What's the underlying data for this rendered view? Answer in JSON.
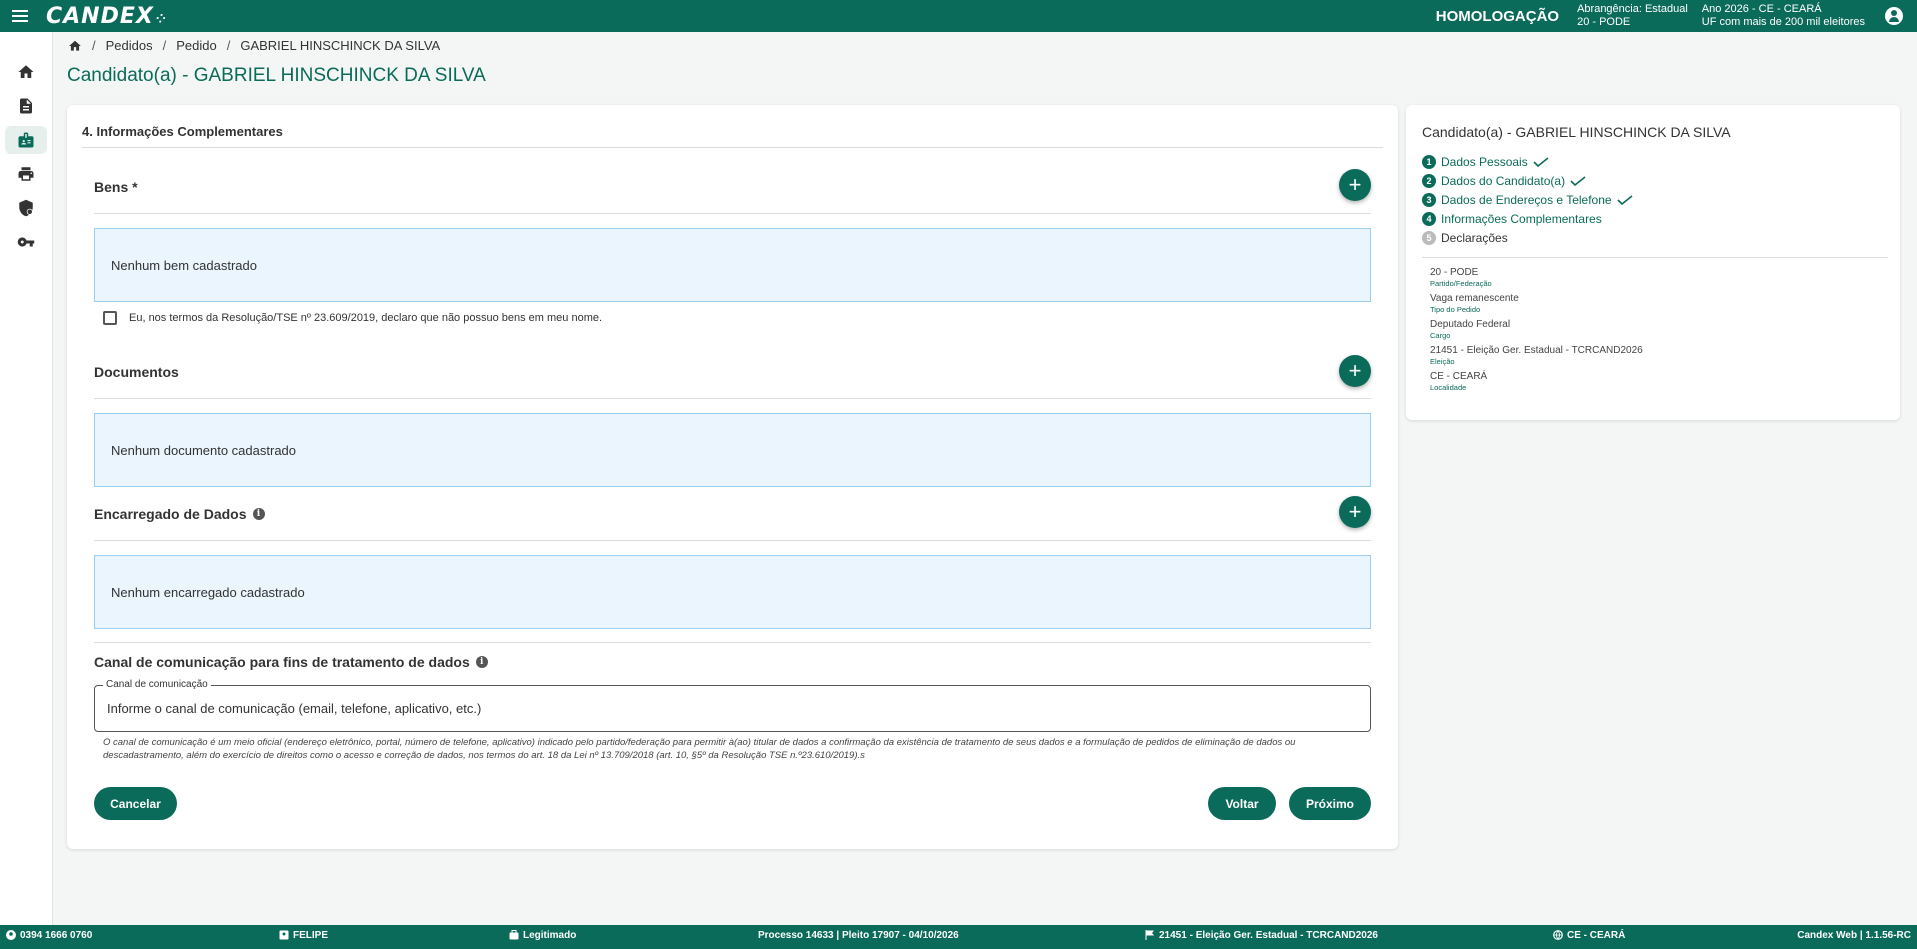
{
  "topbar": {
    "logo": "CANDEX",
    "environment": "HOMOLOGAÇÃO",
    "scope_line1": "Abrangência: Estadual",
    "scope_line2": "20 - PODE",
    "year_line1": "Ano 2026 - CE - CEARÁ",
    "year_line2": "UF com mais de 200 mil eleitores"
  },
  "breadcrumb": {
    "items": [
      "Pedidos",
      "Pedido",
      "GABRIEL HINSCHINCK DA SILVA"
    ]
  },
  "page_title": "Candidato(a) - GABRIEL HINSCHINCK DA SILVA",
  "main": {
    "section_title": "4. Informações Complementares",
    "bens": {
      "title": "Bens *",
      "empty": "Nenhum bem cadastrado",
      "checkbox_label": "Eu, nos termos da Resolução/TSE nº 23.609/2019, declaro que não possuo bens em meu nome."
    },
    "documentos": {
      "title": "Documentos",
      "empty": "Nenhum documento cadastrado"
    },
    "encarregado": {
      "title": "Encarregado de Dados",
      "empty": "Nenhum encarregado cadastrado"
    },
    "canal": {
      "title": "Canal de comunicação para fins de tratamento de dados",
      "field_label": "Canal de comunicação",
      "placeholder": "Informe o canal de comunicação (email, telefone, aplicativo, etc.)",
      "help_text": "O canal de comunicação é um meio oficial (endereço eletrônico, portal, número de telefone, aplicativo) indicado pelo partido/federação para permitir à(ao) titular de dados a confirmação da existência de tratamento de seus dados e a formulação de pedidos de eliminação de dados ou descadastramento, além do exercício de direitos como o acesso e correção de dados, nos termos do art. 18 da Lei nº 13.709/2018 (art. 10, §5º da Resolução TSE n.º23.610/2019).s"
    },
    "buttons": {
      "cancel": "Cancelar",
      "back": "Voltar",
      "next": "Próximo"
    }
  },
  "side_panel": {
    "title": "Candidato(a) - GABRIEL HINSCHINCK DA SILVA",
    "steps": [
      {
        "num": "1",
        "label": "Dados Pessoais",
        "done": true
      },
      {
        "num": "2",
        "label": "Dados do Candidato(a)",
        "done": true
      },
      {
        "num": "3",
        "label": "Dados de Endereços e Telefone",
        "done": true
      },
      {
        "num": "4",
        "label": "Informações Complementares",
        "done": false
      },
      {
        "num": "5",
        "label": "Declarações",
        "done": false
      }
    ],
    "meta": [
      {
        "value": "20 - PODE",
        "label": "Partido/Federação"
      },
      {
        "value": "Vaga remanescente",
        "label": "Tipo do Pedido"
      },
      {
        "value": "Deputado Federal",
        "label": "Cargo"
      },
      {
        "value": "21451 - Eleição Ger. Estadual - TCRCAND2026",
        "label": "Eleição"
      },
      {
        "value": "CE - CEARÁ",
        "label": "Localidade"
      }
    ]
  },
  "footer": {
    "phone": "0394 1666 0760",
    "user": "FELIPE",
    "status": "Legitimado",
    "process": "Processo 14633 | Pleito 17907 - 04/10/2026",
    "election": "21451 - Eleição Ger. Estadual - TCRCAND2026",
    "locality": "CE - CEARÁ",
    "version": "Candex Web | 1.1.56-RC"
  },
  "colors": {
    "primary": "#0b6b5a",
    "empty_box_bg": "#eaf5fd",
    "empty_box_border": "#9ccfee"
  },
  "icons": {
    "sidebar": [
      "home-icon",
      "document-icon",
      "candidate-badge-icon",
      "printer-icon",
      "shield-user-icon",
      "key-icon"
    ]
  }
}
